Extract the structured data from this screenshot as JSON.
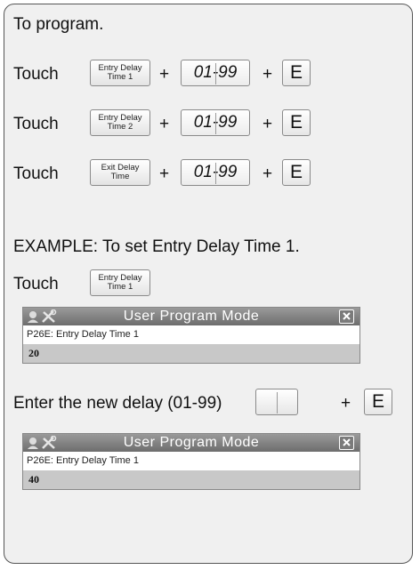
{
  "heading": "To program.",
  "touch_label": "Touch",
  "plus": "+",
  "code": "01-99",
  "enter_key": "E",
  "rows": [
    {
      "line1": "Entry Delay",
      "line2": "Time 1"
    },
    {
      "line1": "Entry Delay",
      "line2": "Time 2"
    },
    {
      "line1": "Exit Delay",
      "line2": "Time"
    }
  ],
  "example": {
    "title": "EXAMPLE: To set Entry Delay Time 1.",
    "button": {
      "line1": "Entry Delay",
      "line2": "Time 1"
    },
    "enter_text": "Enter the new delay (01-99)"
  },
  "screens": [
    {
      "title": "User Program Mode",
      "label": "P26E: Entry Delay Time 1",
      "value": "20"
    },
    {
      "title": "User Program Mode",
      "label": "P26E: Entry Delay Time 1",
      "value": "40"
    }
  ]
}
